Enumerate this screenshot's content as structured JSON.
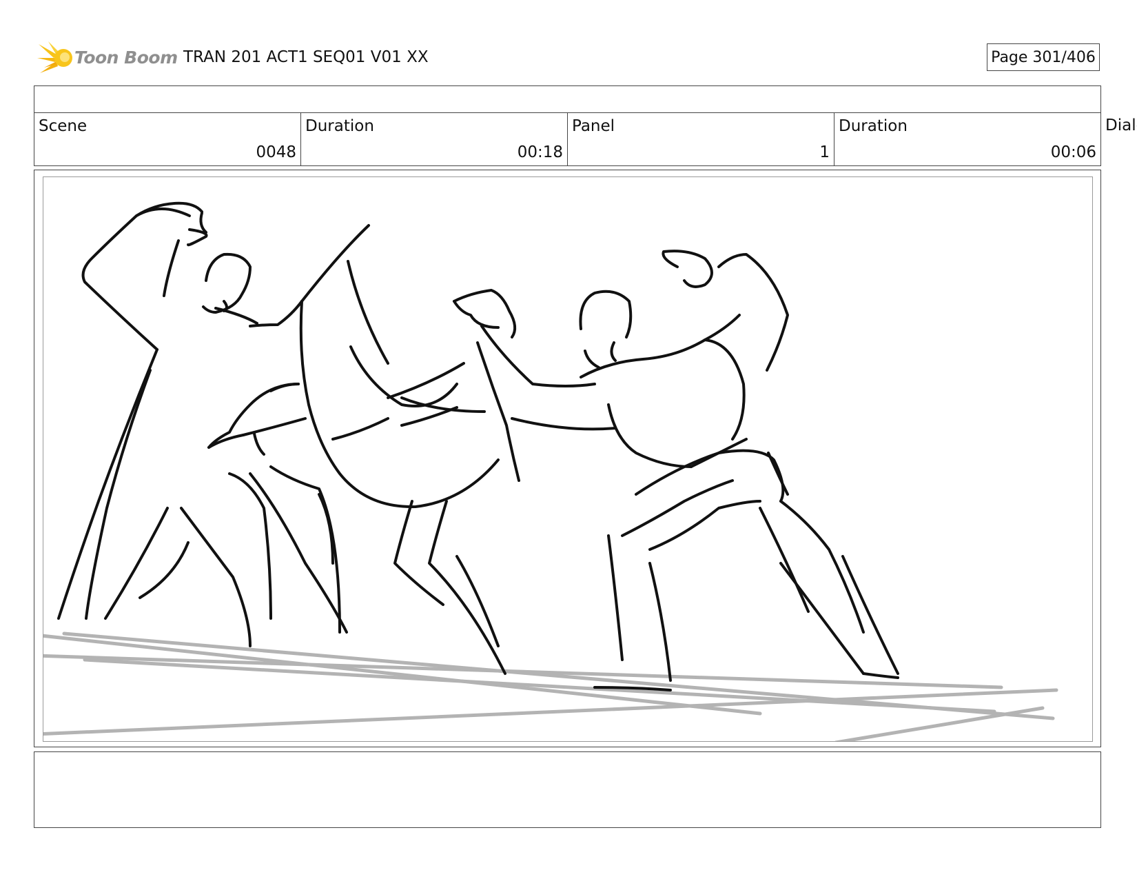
{
  "header": {
    "logo_text": "Toon Boom",
    "document_title": "TRAN 201 ACT1 SEQ01 V01 XX",
    "page_label": "Page 301/406"
  },
  "info": {
    "scene_label": "Scene",
    "scene_value": "0048",
    "scene_duration_label": "Duration",
    "scene_duration_value": "00:18",
    "panel_label": "Panel",
    "panel_value": "1",
    "panel_duration_label": "Duration",
    "panel_duration_value": "00:06",
    "overflow_label": "Dialo"
  },
  "colors": {
    "logo_accent": "#f5c518",
    "sketch_ink": "#111111",
    "perspective_lines": "#b3b3b3"
  },
  "icons": {
    "logo": "sunburst-logo-icon"
  }
}
